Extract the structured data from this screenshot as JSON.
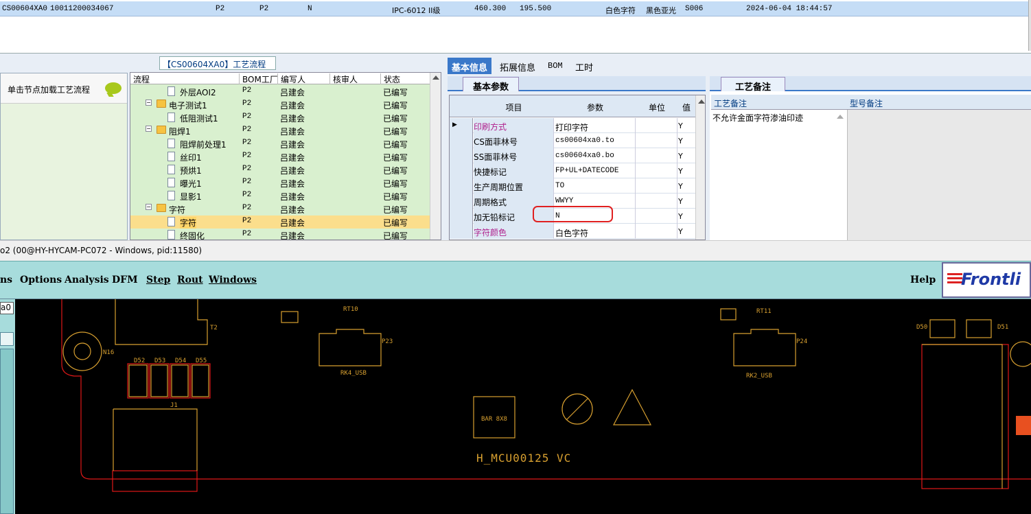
{
  "top_row": {
    "code": "CS00604XA0",
    "order_no": "10011200034067",
    "p1": "P2",
    "p2": "P2",
    "flag": "N",
    "level": "IPC-6012 II级",
    "w": "460.300",
    "h": "195.500",
    "char_color": "白色字符",
    "ink": "黑色亚光",
    "spec": "S006",
    "datetime": "2024-06-04 18:44:57"
  },
  "left_panel": {
    "hint": "单击节点加载工艺流程"
  },
  "flow_title": "【CS00604XA0】工艺流程",
  "tree": {
    "headers": [
      "流程",
      "BOM工厂",
      "编写人",
      "核审人",
      "状态"
    ],
    "rows": [
      {
        "name": "外层AOI2",
        "bom": "P2",
        "writer": "吕建会",
        "status": "已编写",
        "level": 2,
        "type": "doc"
      },
      {
        "name": "电子测试1",
        "bom": "P2",
        "writer": "吕建会",
        "status": "已编写",
        "level": 1,
        "type": "folder"
      },
      {
        "name": "低阻测试1",
        "bom": "P2",
        "writer": "吕建会",
        "status": "已编写",
        "level": 2,
        "type": "doc"
      },
      {
        "name": "阻焊1",
        "bom": "P2",
        "writer": "吕建会",
        "status": "已编写",
        "level": 1,
        "type": "folder"
      },
      {
        "name": "阻焊前处理1",
        "bom": "P2",
        "writer": "吕建会",
        "status": "已编写",
        "level": 2,
        "type": "doc"
      },
      {
        "name": "丝印1",
        "bom": "P2",
        "writer": "吕建会",
        "status": "已编写",
        "level": 2,
        "type": "doc"
      },
      {
        "name": "预烘1",
        "bom": "P2",
        "writer": "吕建会",
        "status": "已编写",
        "level": 2,
        "type": "doc"
      },
      {
        "name": "曝光1",
        "bom": "P2",
        "writer": "吕建会",
        "status": "已编写",
        "level": 2,
        "type": "doc"
      },
      {
        "name": "显影1",
        "bom": "P2",
        "writer": "吕建会",
        "status": "已编写",
        "level": 2,
        "type": "doc"
      },
      {
        "name": "字符",
        "bom": "P2",
        "writer": "吕建会",
        "status": "已编写",
        "level": 1,
        "type": "folder"
      },
      {
        "name": "字符",
        "bom": "P2",
        "writer": "吕建会",
        "status": "已编写",
        "level": 2,
        "type": "doc",
        "selected": true
      },
      {
        "name": "终固化",
        "bom": "P2",
        "writer": "吕建会",
        "status": "已编写",
        "level": 2,
        "type": "doc"
      }
    ]
  },
  "tabs": [
    "基本信息",
    "拓展信息",
    "BOM",
    "工时"
  ],
  "subtab": "基本参数",
  "grid": {
    "headers": [
      "项目",
      "参数",
      "单位",
      "值"
    ],
    "rows": [
      {
        "item": "印刷方式",
        "param": "打印字符",
        "unit": "",
        "v": "Y",
        "item_color": "#b0208c",
        "current": true
      },
      {
        "item": "CS面菲林号",
        "param": "cs00604xa0.to",
        "unit": "",
        "v": "Y"
      },
      {
        "item": "SS面菲林号",
        "param": "cs00604xa0.bo",
        "unit": "",
        "v": "Y"
      },
      {
        "item": "快捷标记",
        "param": "FP+UL+DATECODE",
        "unit": "",
        "v": "Y"
      },
      {
        "item": "生产周期位置",
        "param": "TO",
        "unit": "",
        "v": "Y"
      },
      {
        "item": "周期格式",
        "param": "WWYY",
        "unit": "",
        "v": "Y"
      },
      {
        "item": "加无铅标记",
        "param": "N",
        "unit": "",
        "v": "Y"
      },
      {
        "item": "字符颜色",
        "param": "白色字符",
        "unit": "",
        "v": "Y",
        "item_color": "#b0208c"
      }
    ]
  },
  "notes": {
    "tab": "工艺备注",
    "col1": "工艺备注",
    "col2": "型号备注",
    "text": "不允许金面字符渗油印迹"
  },
  "status_text": "o2 (00@HY-HYCAM-PC072 - Windows, pid:11580)",
  "menu": [
    {
      "label": "ns",
      "u": false
    },
    {
      "label": "Options",
      "u": false
    },
    {
      "label": "Analysis",
      "u": false
    },
    {
      "label": "DFM",
      "u": false
    },
    {
      "label": "Step",
      "u": true
    },
    {
      "label": "Rout",
      "u": true
    },
    {
      "label": "Windows",
      "u": true
    }
  ],
  "help": "Help",
  "logo": "Frontli",
  "cad_side": "a0",
  "cad_labels": {
    "mcu": "H_MCU00125 VC",
    "bar": "BAR 8X8",
    "usb1": "RK4_USB",
    "usb2": "RK2_USB",
    "p23": "P23",
    "p24": "P24",
    "rt10": "RT10",
    "rt11": "RT11",
    "n16": "N16",
    "t2": "T2",
    "j1": "J1",
    "d52": "D52",
    "d53": "D53",
    "d54": "D54",
    "d55": "D55",
    "d50": "D50",
    "d51": "D51"
  }
}
